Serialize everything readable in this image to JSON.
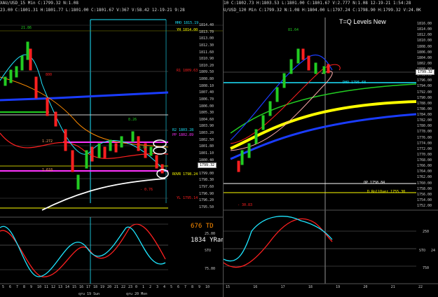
{
  "left": {
    "title_bar": "XAU/USD_15 Min  C:1799.32  N:1.08",
    "header": "23.00  C:1801.31  H:1801.77  L:1801.00  C:1801.67  V:367  V:58.42  12-19-21  9:28",
    "y_ticks": [
      "1814.40",
      "1813.70",
      "1813.00",
      "1812.30",
      "1811.60",
      "1810.90",
      "1810.20",
      "1809.50",
      "1808.80",
      "1808.10",
      "1807.40",
      "1806.70",
      "1806.00",
      "1805.30",
      "1804.60",
      "1803.90",
      "1803.20",
      "1802.50",
      "1801.80",
      "1801.10",
      "1800.40",
      "1799.70",
      "1799.00",
      "1798.30",
      "1797.60",
      "1796.90",
      "1796.20",
      "1795.50"
    ],
    "price_tag": "1799.32",
    "levels": {
      "hh": "HHO 1815.19",
      "yh": "YH 1814.00",
      "r1": "R1 1809.63",
      "r2": "R2 1803.28",
      "pp": "PP 1802.89",
      "rovr": "ROVR 1798.24",
      "yl": "YL 1795.14"
    },
    "annotations": {
      "high": "21.86",
      "mid": "8.26",
      "low": "- 0.76",
      "left_a": "800",
      "left_b": "1.272",
      "left_c": "1.618",
      "center": "6.00"
    },
    "text_676": "676 TD",
    "text_1834": "1834 YRan",
    "osc_labels": [
      "25.00",
      "STO",
      "75.00"
    ],
    "x_ticks": [
      "5",
      "6",
      "7",
      "8",
      "9",
      "10",
      "11",
      "12",
      "13",
      "14",
      "15",
      "16",
      "17",
      "18",
      "19",
      "20",
      "21",
      "22",
      "23",
      "0",
      "1",
      "2",
      "3",
      "4",
      "5",
      "6",
      "7",
      "8",
      "9",
      "10"
    ],
    "dates": [
      "qru 19 Sun",
      "qru 20 Mon"
    ]
  },
  "right": {
    "header": "10  C:1802.73  H:1803.53  L:1801.00  C:1801.67  V:2.777  N:1.08  12-19-21  1:54:28",
    "sub_header": "U/USD_120 Min  C:1799.32  N:1.08  H:1804.00  L:1797.24  C:1798.90  H:1799.32  V:24.0K",
    "title": "T=Q Levels New",
    "y_ticks": [
      "1816.00",
      "1814.00",
      "1812.00",
      "1810.00",
      "1808.00",
      "1806.00",
      "1804.00",
      "1802.00",
      "1800.00",
      "1798.00",
      "1796.00",
      "1794.00",
      "1792.00",
      "1790.00",
      "1788.00",
      "1786.00",
      "1784.00",
      "1782.00",
      "1780.00",
      "1778.00",
      "1776.00",
      "1774.00",
      "1772.00",
      "1770.00",
      "1768.00",
      "1766.00",
      "1764.00",
      "1762.00",
      "1760.00",
      "1758.00",
      "1756.00",
      "1754.00",
      "1752.00"
    ],
    "price_tag": "1799.32",
    "levels": {
      "dho": "DHO 1795.68",
      "op": "OP 1758.84",
      "rollover": "D RollOver 1755.30"
    },
    "annotations": {
      "high": "81.64",
      "low": "- 30.83"
    },
    "osc_labels": [
      "250",
      "STO",
      "24",
      "750"
    ],
    "x_ticks": [
      "15",
      "16",
      "17",
      "18",
      "19",
      "20",
      "21",
      "22"
    ]
  },
  "colors": {
    "bg": "#000000",
    "cyan": "#1ee6ff",
    "magenta": "#ff33ff",
    "blue": "#1a3cff",
    "yellow": "#ffff00",
    "red": "#ff2020",
    "green": "#22cc22",
    "orange": "#ff8c00",
    "white": "#ffffff"
  }
}
